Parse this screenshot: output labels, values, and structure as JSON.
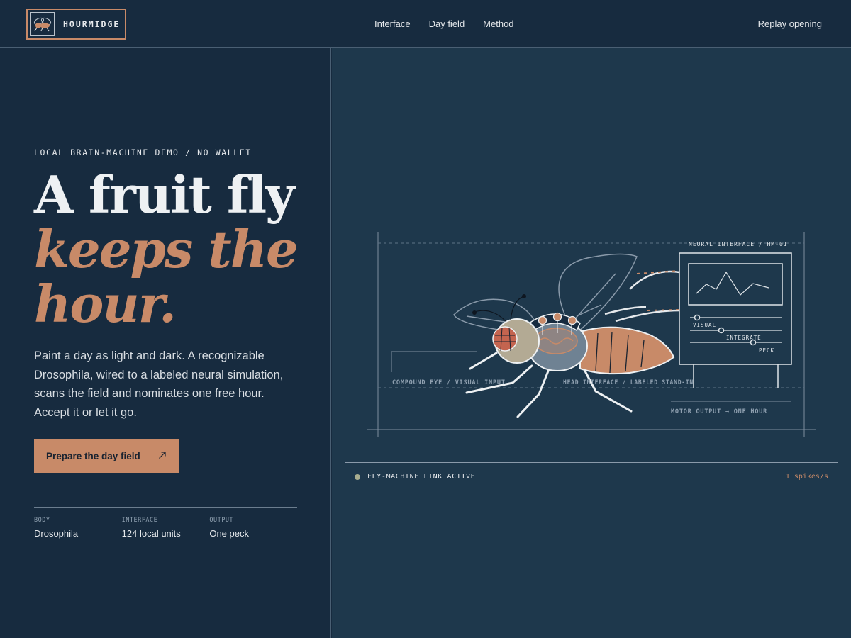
{
  "header": {
    "brand": "HOURMIDGE",
    "nav": [
      "Interface",
      "Day field",
      "Method"
    ],
    "replay": "Replay opening"
  },
  "hero": {
    "eyebrow": "LOCAL BRAIN-MACHINE DEMO / NO WALLET",
    "title_line1": "A fruit fly",
    "title_line2": "keeps the",
    "title_line3": "hour.",
    "lede": "Paint a day as light and dark. A recognizable Drosophila, wired to a labeled neural simulation, scans the field and nominates one free hour. Accept it or let it go.",
    "cta": "Prepare the day field",
    "cta_icon": "arrow-up-right-icon"
  },
  "stats": [
    {
      "label": "BODY",
      "value": "Drosophila"
    },
    {
      "label": "INTERFACE",
      "value": "124 local units"
    },
    {
      "label": "OUTPUT",
      "value": "One peck"
    }
  ],
  "diagram": {
    "panel_title": "NEURAL INTERFACE / HM-01",
    "slider_labels": [
      "VISUAL",
      "INTEGRATE",
      "PECK"
    ],
    "eye_label": "COMPOUND EYE / VISUAL INPUT",
    "head_label": "HEAD INTERFACE / LABELED STAND-IN",
    "motor_label": "MOTOR OUTPUT → ONE HOUR"
  },
  "status": {
    "text": "FLY-MACHINE LINK ACTIVE",
    "rate": "1 spikes/s",
    "dot_color": "#a8ad8f"
  },
  "colors": {
    "accent": "#c88a68",
    "background": "#172b3f",
    "panel": "#1e384c"
  }
}
